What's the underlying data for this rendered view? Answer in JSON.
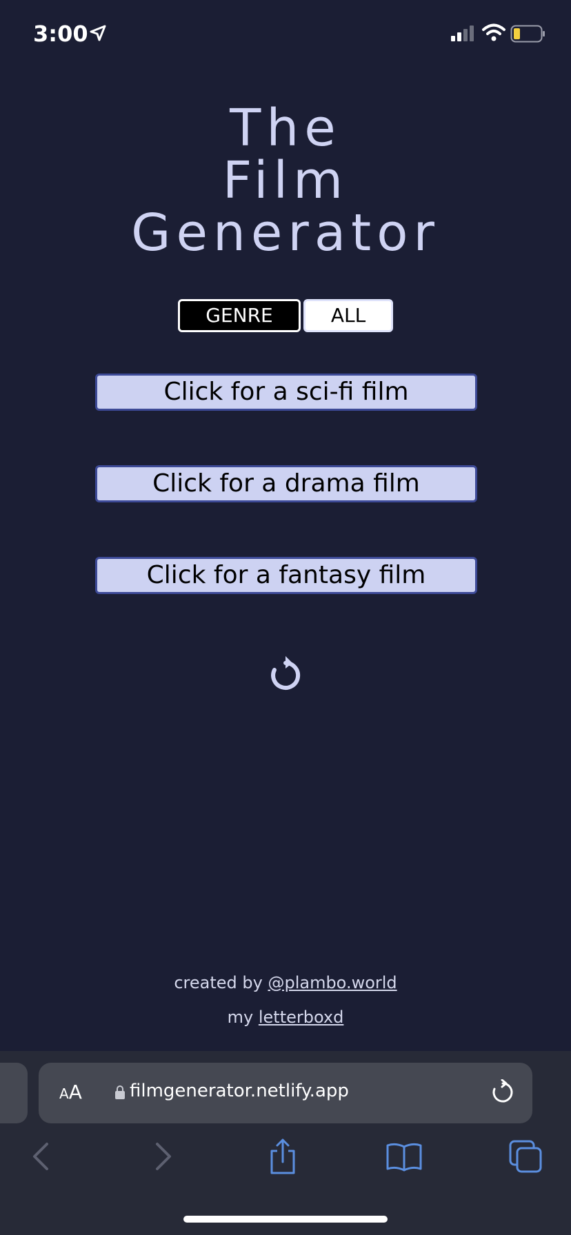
{
  "status_bar": {
    "time": "3:00",
    "icons": [
      "location-arrow-icon",
      "cellular-signal-icon",
      "wifi-icon",
      "battery-low-icon"
    ]
  },
  "title": {
    "line1": "The",
    "line2": "Film",
    "line3": "Generator"
  },
  "mode_toggle": {
    "genre_label": "GENRE",
    "all_label": "ALL",
    "selected": "GENRE"
  },
  "genre_buttons": [
    {
      "label": "Click for a sci-fi film"
    },
    {
      "label": "Click for a drama film"
    },
    {
      "label": "Click for a fantasy film"
    }
  ],
  "refresh_icon": "refresh-icon",
  "footer": {
    "created_prefix": "created by",
    "created_link": "@plambo.world",
    "my_prefix": "my",
    "my_link": "letterboxd"
  },
  "browser": {
    "text_size_label_small": "A",
    "text_size_label_large": "A",
    "url": "filmgenerator.netlify.app",
    "nav_icons": [
      "back-icon",
      "forward-icon",
      "share-icon",
      "bookmarks-icon",
      "tabs-icon"
    ]
  },
  "colors": {
    "background": "#1b1e34",
    "title": "#cfd3f3",
    "button_fill": "#cdd2f2",
    "button_border": "#3d4a97",
    "browser_bar": "#272a37",
    "url_field": "#454852",
    "nav_icon_blue": "#5b8fe0",
    "battery_yellow": "#f4d03f"
  }
}
